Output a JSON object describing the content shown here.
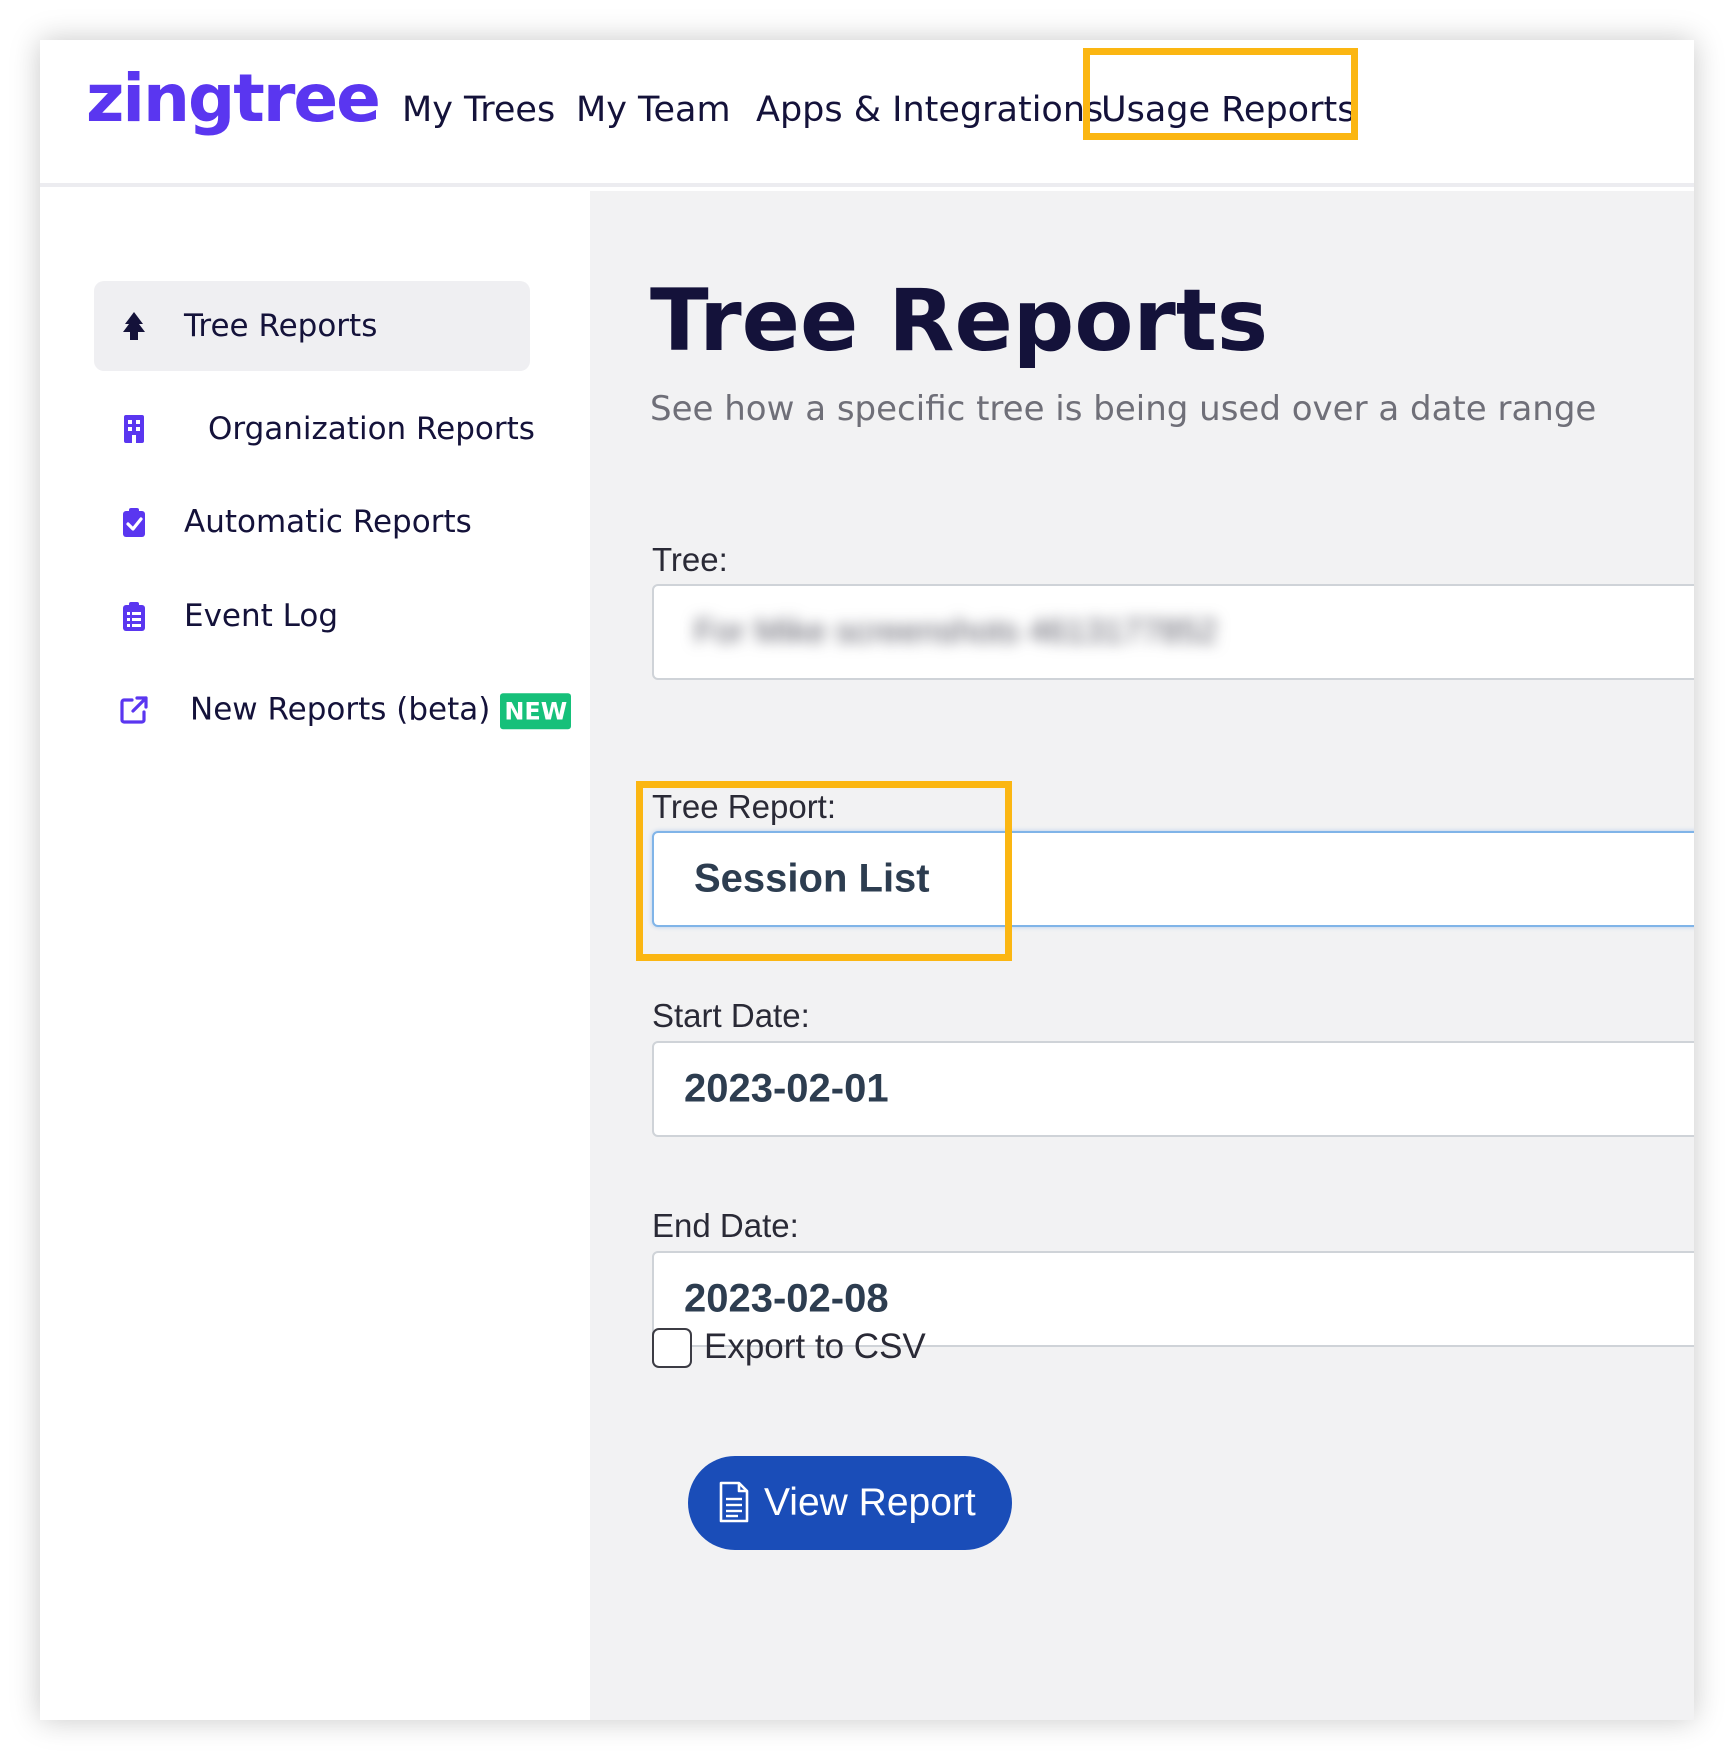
{
  "brand": {
    "logo_text": "zingtree",
    "accent": "#5a36f0",
    "highlight": "#fbb612"
  },
  "nav": {
    "items": [
      {
        "label": "My Trees"
      },
      {
        "label": "My Team"
      },
      {
        "label": "Apps & Integrations"
      },
      {
        "label": "Usage Reports",
        "highlighted": true
      }
    ]
  },
  "sidebar": {
    "items": [
      {
        "label": "Tree Reports",
        "icon": "tree-icon",
        "active": true
      },
      {
        "label": "Organization Reports",
        "icon": "building-icon"
      },
      {
        "label": "Automatic Reports",
        "icon": "clipboard-check-icon"
      },
      {
        "label": "Event Log",
        "icon": "clipboard-list-icon"
      },
      {
        "label": "New Reports (beta)",
        "icon": "external-link-icon",
        "badge": "NEW"
      }
    ]
  },
  "main": {
    "title": "Tree Reports",
    "subtitle": "See how a specific tree is being used over a date range",
    "fields": {
      "tree": {
        "label": "Tree:",
        "value": "For Mike screenshots 4613177852"
      },
      "tree_report": {
        "label": "Tree Report:",
        "value": "Session List"
      },
      "start_date": {
        "label": "Start Date:",
        "value": "2023-02-01"
      },
      "end_date": {
        "label": "End Date:",
        "value": "2023-02-08"
      }
    },
    "export_csv": {
      "label": "Export to CSV",
      "checked": false
    },
    "view_button": {
      "label": "View Report",
      "icon": "document-icon",
      "color": "#1a4db8"
    }
  }
}
